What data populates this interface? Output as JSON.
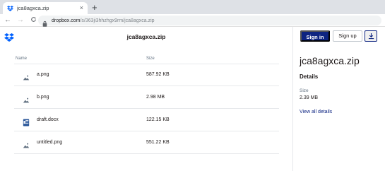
{
  "browser": {
    "tab_title": "jca8agxca.zip",
    "tab_close": "×",
    "new_tab": "+",
    "nav_back": "←",
    "nav_forward": "→",
    "nav_reload": "C",
    "url_host": "dropbox.com",
    "url_path": "/s/363ji3hhzhgx9rm/jca8agxca.zip"
  },
  "page": {
    "file_title": "jca8agxca.zip",
    "columns": {
      "name": "Name",
      "size": "Size"
    },
    "files": [
      {
        "name": "a.png",
        "size": "587.92 KB",
        "icon": "image-file-icon"
      },
      {
        "name": "b.png",
        "size": "2.98 MB",
        "icon": "image-file-icon"
      },
      {
        "name": "draft.docx",
        "size": "122.15 KB",
        "icon": "word-doc-icon"
      },
      {
        "name": "untitled.png",
        "size": "551.22 KB",
        "icon": "image-file-icon"
      }
    ]
  },
  "sidepanel": {
    "signin_label": "Sign in",
    "signup_label": "Sign up",
    "title": "jca8agxca.zip",
    "details_heading": "Details",
    "size_label": "Size",
    "size_value": "2.39 MB",
    "view_all_link": "View all details"
  },
  "colors": {
    "brand_blue": "#0d2481",
    "dropbox_blue": "#0061fe",
    "muted_text": "#637282"
  }
}
